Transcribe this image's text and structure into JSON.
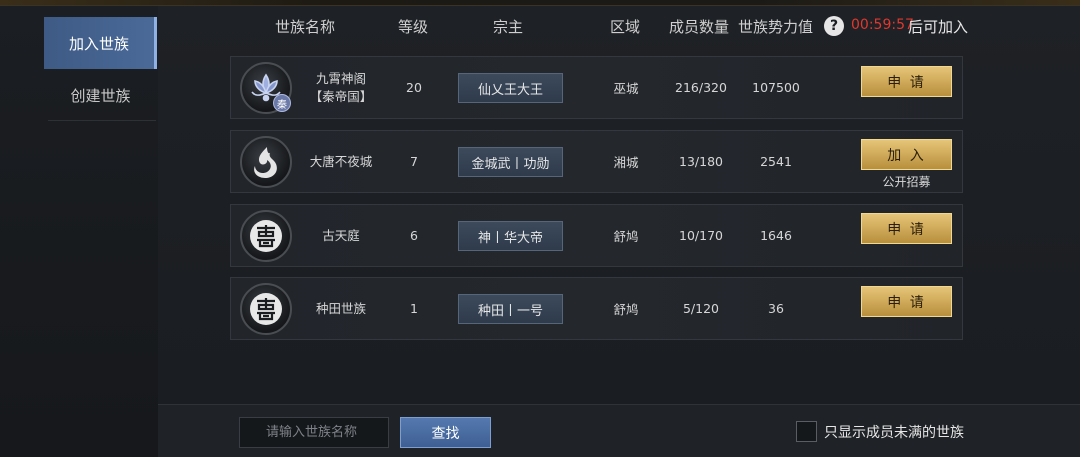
{
  "sidebar": {
    "tabs": [
      {
        "label": "加入世族",
        "active": true
      },
      {
        "label": "创建世族",
        "active": false
      }
    ]
  },
  "header": {
    "name": "世族名称",
    "level": "等级",
    "leader": "宗主",
    "region": "区域",
    "members": "成员数量",
    "power": "世族势力值",
    "help_icon": "?",
    "timer": "00:59:57",
    "timer_suffix": "后可加入"
  },
  "clans": [
    {
      "name_line1": "九霄神阁",
      "name_line2": "【秦帝国】",
      "level": "20",
      "leader": "仙乂王大王",
      "region": "巫城",
      "members": "216/320",
      "power": "107500",
      "action": "申 请",
      "note": "",
      "emblem": "lotus-emblem-icon",
      "badge": "秦"
    },
    {
      "name_line1": "大唐不夜城",
      "name_line2": "",
      "level": "7",
      "leader": "金城武丨功勋",
      "region": "湘城",
      "members": "13/180",
      "power": "2541",
      "action": "加 入",
      "note": "公开招募",
      "emblem": "flame-emblem-icon",
      "badge": ""
    },
    {
      "name_line1": "古天庭",
      "name_line2": "",
      "level": "6",
      "leader": "神丨华大帝",
      "region": "舒鸠",
      "members": "10/170",
      "power": "1646",
      "action": "申 请",
      "note": "",
      "emblem": "shou-emblem-icon",
      "badge": ""
    },
    {
      "name_line1": "种田世族",
      "name_line2": "",
      "level": "1",
      "leader": "种田丨一号",
      "region": "舒鸠",
      "members": "5/120",
      "power": "36",
      "action": "申 请",
      "note": "",
      "emblem": "shou-emblem-icon",
      "badge": ""
    }
  ],
  "bottom": {
    "search_placeholder": "请输入世族名称",
    "find_label": "查找",
    "filter_label": "只显示成员未满的世族",
    "filter_checked": false
  },
  "colors": {
    "accent_blue": "#4b6a98",
    "gold_button": "#d4b060",
    "timer_red": "#e0382e"
  }
}
